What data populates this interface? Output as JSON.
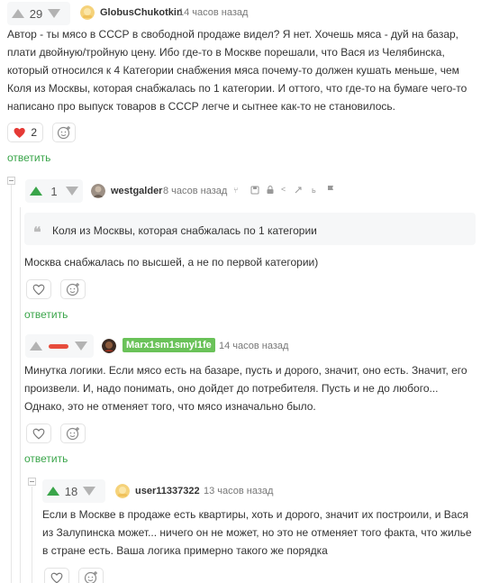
{
  "comments": [
    {
      "votes": "29",
      "author": "GlobusChukotkin",
      "time": "14 часов назад",
      "text": "Автор - ты мясо в СССР в свободной продаже видел? Я нет. Хочешь мяса - дуй на базар, плати двойную/тройную цену. Ибо где-то в Москве порешали, что Вася из Челябинска, который относился к 4 Категории снабжения мяса почему-то должен кушать меньше, чем Коля из Москвы, которая снабжалась по 1 категории. И оттого, что где-то на бумаге чего-то написано про выпуск товаров в СССР легче и сытнее как-то не становилось.",
      "likes": "2",
      "reply_label": "ответить"
    },
    {
      "votes": "1",
      "author": "westgalder",
      "time": "8 часов назад",
      "quote": "Коля из Москвы, которая снабжалась по 1 категории",
      "text": "Москва снабжалась по высшей, а не по первой категории)",
      "reply_label": "ответить"
    },
    {
      "author": "Marx1sm1smyl1fe",
      "time": "14 часов назад",
      "text": "Минутка логики. Если мясо есть на базаре, пусть и дорого, значит, оно есть. Значит, его произвели. И, надо понимать, оно дойдет до потребителя. Пусть и не до любого... Однако, это не отменяет того, что мясо изначально было.",
      "reply_label": "ответить"
    },
    {
      "votes": "18",
      "author": "user11337322",
      "time": "13 часов назад",
      "text": "Если в Москве в продаже есть квартиры, хоть и дорого, значит их построили, и Вася из Залупинска может... ничего он не может, но это не отменяет того факта, что жилье в стране есть. Ваша логика примерно такого же порядка"
    }
  ],
  "icons": {
    "upvote": "triangle-up",
    "downvote": "triangle-down",
    "heart": "heart-icon",
    "smile_add": "emoji-add-icon",
    "quote": "quote-icon"
  },
  "colors": {
    "accent_green": "#3aa54a",
    "heart_red": "#e53935",
    "negative_red": "#e74c3c",
    "badge_green": "#6ac259"
  }
}
